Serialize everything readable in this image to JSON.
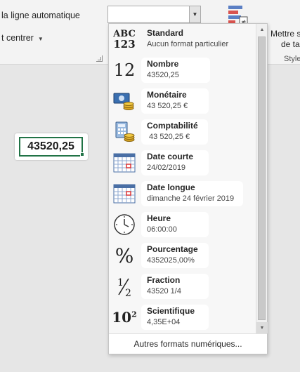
{
  "ribbon": {
    "wrap_text": "la ligne automatique",
    "merge_center": "t centrer",
    "format_combo_value": "",
    "right_line1": "Mettre s",
    "right_line2": "de ta",
    "styles_label": "Style"
  },
  "cell": {
    "value": "43520,25"
  },
  "dropdown": {
    "items": [
      {
        "title": "Standard",
        "sample": "Aucun format particulier",
        "icon": "abc-123-icon"
      },
      {
        "title": "Nombre",
        "sample": "43520,25",
        "icon": "number-12-icon"
      },
      {
        "title": "Monétaire",
        "sample": "43 520,25 €",
        "icon": "currency-icon"
      },
      {
        "title": "Comptabilité",
        "sample": " 43 520,25 €",
        "icon": "accounting-icon"
      },
      {
        "title": "Date courte",
        "sample": "24/02/2019",
        "icon": "calendar-short-icon"
      },
      {
        "title": "Date longue",
        "sample": "dimanche 24 février 2019",
        "icon": "calendar-long-icon"
      },
      {
        "title": "Heure",
        "sample": "06:00:00",
        "icon": "clock-icon"
      },
      {
        "title": "Pourcentage",
        "sample": "4352025,00%",
        "icon": "percent-icon"
      },
      {
        "title": "Fraction",
        "sample": "43520 1/4",
        "icon": "fraction-icon"
      },
      {
        "title": "Scientifique",
        "sample": "4,35E+04",
        "icon": "scientific-icon"
      }
    ],
    "footer": "Autres formats numériques..."
  },
  "icons": {
    "abc_line1": "ABC",
    "abc_line2": "123",
    "number": "12",
    "percent": "%",
    "half_num": "1",
    "half_den": "2",
    "sci_base": "10",
    "sci_exp": "2"
  },
  "colors": {
    "accent_green": "#217346",
    "currency_blue": "#3a6fb0",
    "coin_gold": "#d9a520"
  }
}
